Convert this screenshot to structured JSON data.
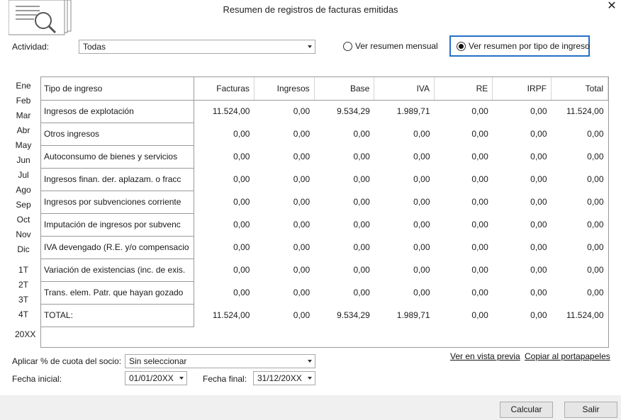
{
  "window": {
    "title": "Resumen de registros de facturas emitidas",
    "close_icon": "✕"
  },
  "filters": {
    "actividad_label": "Actividad:",
    "actividad_value": "Todas",
    "radio_mensual": "Ver resumen mensual",
    "radio_tipo": "Ver resumen por tipo de ingreso",
    "selected_view": "tipo"
  },
  "periods": {
    "months": [
      "Ene",
      "Feb",
      "Mar",
      "Abr",
      "May",
      "Jun",
      "Jul",
      "Ago",
      "Sep",
      "Oct",
      "Nov",
      "Dic"
    ],
    "quarters": [
      "1T",
      "2T",
      "3T",
      "4T"
    ],
    "year": "20XX"
  },
  "table": {
    "columns": [
      "Tipo de ingreso",
      "Facturas",
      "Ingresos",
      "Base",
      "IVA",
      "RE",
      "IRPF",
      "Total"
    ],
    "rows": [
      [
        "Ingresos de explotación",
        "11.524,00",
        "0,00",
        "9.534,29",
        "1.989,71",
        "0,00",
        "0,00",
        "11.524,00"
      ],
      [
        "Otros ingresos",
        "0,00",
        "0,00",
        "0,00",
        "0,00",
        "0,00",
        "0,00",
        "0,00"
      ],
      [
        "Autoconsumo de bienes y servicios",
        "0,00",
        "0,00",
        "0,00",
        "0,00",
        "0,00",
        "0,00",
        "0,00"
      ],
      [
        "Ingresos finan. der. aplazam. o fracc",
        "0,00",
        "0,00",
        "0,00",
        "0,00",
        "0,00",
        "0,00",
        "0,00"
      ],
      [
        "Ingresos por subvenciones corriente",
        "0,00",
        "0,00",
        "0,00",
        "0,00",
        "0,00",
        "0,00",
        "0,00"
      ],
      [
        "Imputación de ingresos por subvenc",
        "0,00",
        "0,00",
        "0,00",
        "0,00",
        "0,00",
        "0,00",
        "0,00"
      ],
      [
        "IVA devengado (R.E. y/o compensacio",
        "0,00",
        "0,00",
        "0,00",
        "0,00",
        "0,00",
        "0,00",
        "0,00"
      ],
      [
        "Variación de existencias (inc. de exis.",
        "0,00",
        "0,00",
        "0,00",
        "0,00",
        "0,00",
        "0,00",
        "0,00"
      ],
      [
        "Trans. elem. Patr. que hayan gozado",
        "0,00",
        "0,00",
        "0,00",
        "0,00",
        "0,00",
        "0,00",
        "0,00"
      ],
      [
        "TOTAL:",
        "11.524,00",
        "0,00",
        "9.534,29",
        "1.989,71",
        "0,00",
        "0,00",
        "11.524,00"
      ]
    ]
  },
  "bottom": {
    "cuota_label": "Aplicar % de cuota del socio:",
    "cuota_value": "Sin seleccionar",
    "fecha_inicial_label": "Fecha inicial:",
    "fecha_inicial_value": "01/01/20XX",
    "fecha_final_label": "Fecha final:",
    "fecha_final_value": "31/12/20XX",
    "link_preview": "Ver en vista previa",
    "link_copy": "Copiar al portapapeles"
  },
  "buttons": {
    "calcular": "Calcular",
    "salir": "Salir"
  },
  "colors": {
    "focus_border": "#2670c7",
    "footer_bg": "#f0f0f0"
  }
}
